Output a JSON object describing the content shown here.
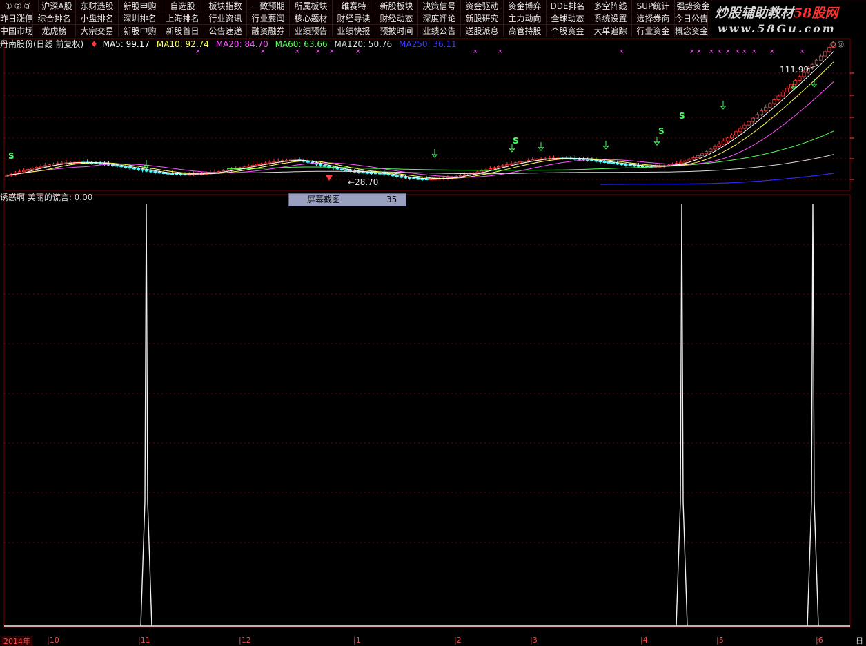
{
  "menu": {
    "row1": [
      "沪深A股",
      "东财选股",
      "新股申购",
      "自选股",
      "板块指数",
      "一致预期",
      "所属板块",
      "维赛特",
      "新股板块",
      "决策信号",
      "资金驱动",
      "资金博弈",
      "DDE排名",
      "多空阵线",
      "SUP统计",
      "强势资金"
    ],
    "row2": [
      "昨日涨停",
      "综合排名",
      "小盘排名",
      "深圳排名",
      "上海排名",
      "行业资讯",
      "行业要闻",
      "核心题材",
      "财经导读",
      "财经动态",
      "深度评论",
      "新股研究",
      "主力动向",
      "全球动态",
      "系统设置",
      "选择券商",
      "今日公告"
    ],
    "row3": [
      "中国市场",
      "龙虎榜",
      "大宗交易",
      "新股申购",
      "新股首日",
      "公告速递",
      "融资融券",
      "业绩预告",
      "业绩快报",
      "预披时间",
      "业绩公告",
      "送股派息",
      "高管持股",
      "个股资金",
      "大单追踪",
      "行业资金",
      "概念资金"
    ],
    "icons": "①②③"
  },
  "brand": {
    "line1_a": "炒股辅助教材",
    "line1_b": "58股网",
    "line2": "www.58Gu.com"
  },
  "main_legend": {
    "title": "丹南股份(日线 前复权)",
    "ma5": "MA5: 99.17",
    "ma10": "MA10: 92.74",
    "ma20": "MA20: 84.70",
    "ma60": "MA60: 63.66",
    "ma120": "MA120: 50.76",
    "ma250": "MA250: 36.11"
  },
  "sub_legend": {
    "text": "诱惑啊  美丽的谎言: 0.00"
  },
  "annotations": {
    "high": "111.99",
    "low": "28.70"
  },
  "screenshot_box": {
    "label": "屏幕截图",
    "value": "35"
  },
  "time_axis": {
    "start": "2014年",
    "ticks": [
      "10",
      "11",
      "12",
      "1",
      "2",
      "3",
      "4",
      "5",
      "6"
    ]
  },
  "axis_corner": "日",
  "colors": {
    "ma5": "#ffffff",
    "ma10": "#ffff55",
    "ma20": "#ff55ff",
    "ma60": "#55ff55",
    "ma120": "#dddddd",
    "ma250": "#2a2aff",
    "up": "#ff3a3a",
    "down": "#54ffff",
    "grid": "#7a0000"
  }
}
